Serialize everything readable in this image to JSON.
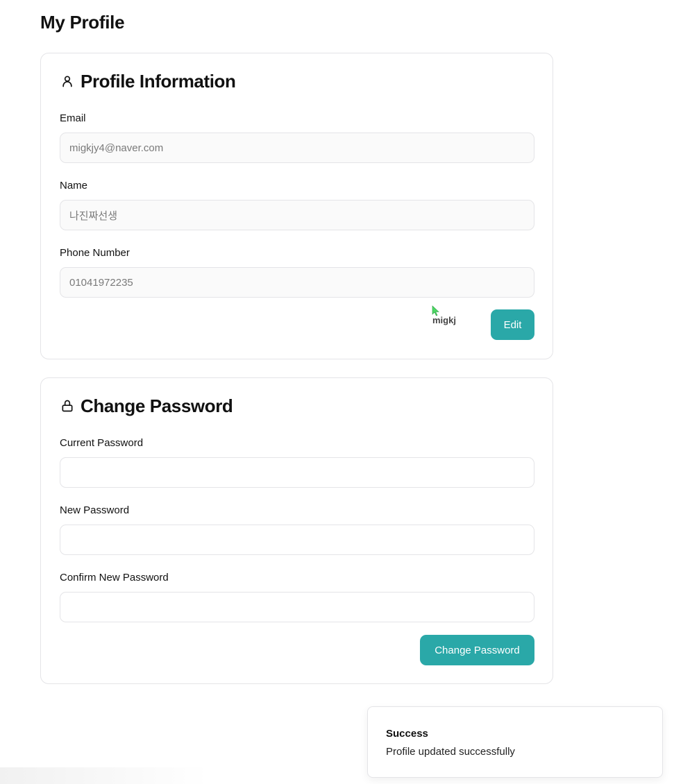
{
  "page": {
    "title": "My Profile"
  },
  "profile_card": {
    "title": "Profile Information",
    "icon": "user-icon",
    "fields": [
      {
        "label": "Email",
        "value": "migkjy4@naver.com"
      },
      {
        "label": "Name",
        "value": "나진짜선생"
      },
      {
        "label": "Phone Number",
        "value": "01041972235"
      }
    ],
    "edit_label": "Edit"
  },
  "password_card": {
    "title": "Change Password",
    "icon": "lock-icon",
    "fields": [
      {
        "label": "Current Password",
        "value": ""
      },
      {
        "label": "New Password",
        "value": ""
      },
      {
        "label": "Confirm New Password",
        "value": ""
      }
    ],
    "submit_label": "Change Password"
  },
  "cursor": {
    "label": "migkj",
    "color": "#4cd964"
  },
  "toast": {
    "title": "Success",
    "message": "Profile updated successfully"
  },
  "colors": {
    "accent": "#2aa8a8",
    "border": "#e4e4e7"
  }
}
